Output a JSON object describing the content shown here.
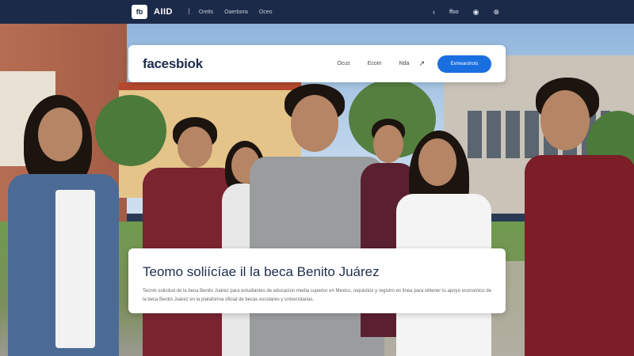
{
  "topbar": {
    "logo_text": "fb",
    "brand": "AIID",
    "links": [
      "Orells",
      "Oaerbora",
      "Oceo"
    ],
    "right_items": [
      "ffoo",
      "◉",
      "⊗"
    ]
  },
  "header": {
    "logo": "facesbiok",
    "nav": [
      "Ocus",
      "Ecom",
      "Nda"
    ],
    "icon": "↗",
    "cta_label": "Exmearshots"
  },
  "content": {
    "title": "Teomo soliícíae il la beca Benito Juárez",
    "body": "Tecnm solicitud de la beca Benito Juárez para estudiantes de educacion media superior en Mexico, requisitos y registro en linea para obtener tu apoyo economico de la beca Benito Juárez en la plataforma oficial de becas escolares y universitarias."
  }
}
